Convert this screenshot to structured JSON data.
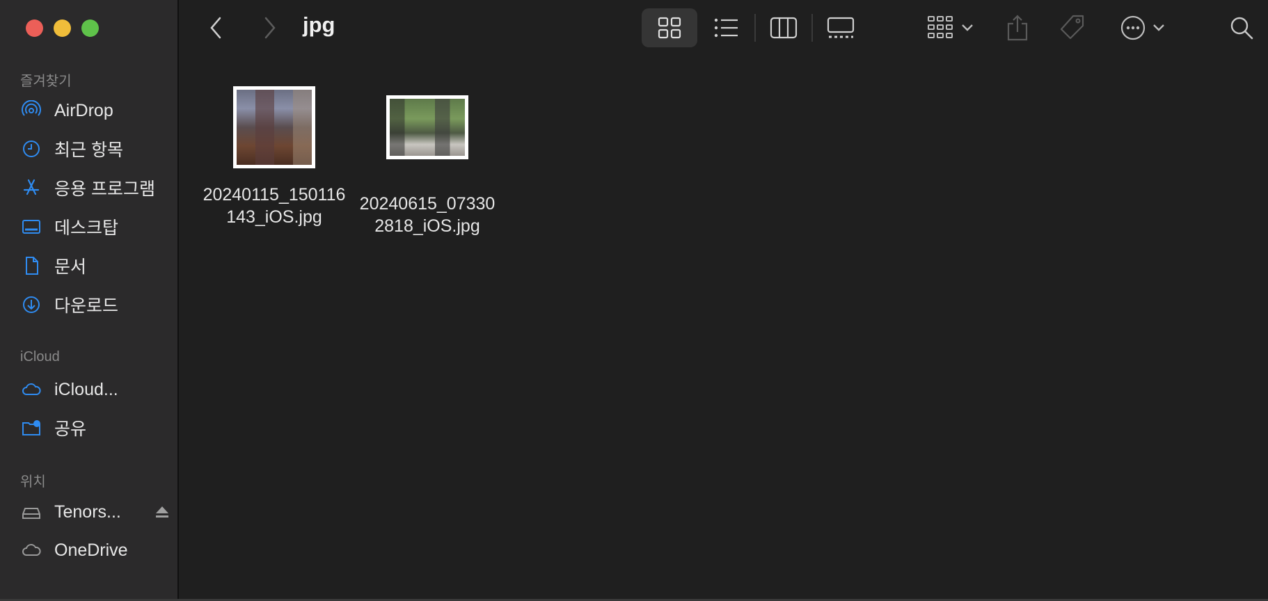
{
  "window": {
    "title": "jpg"
  },
  "sidebar": {
    "sections": [
      {
        "title": "즐겨찾기",
        "items": [
          {
            "label": "AirDrop",
            "icon": "airdrop-icon"
          },
          {
            "label": "최근 항목",
            "icon": "clock-icon"
          },
          {
            "label": "응용 프로그램",
            "icon": "applications-icon"
          },
          {
            "label": "데스크탑",
            "icon": "desktop-icon"
          },
          {
            "label": "문서",
            "icon": "document-icon"
          },
          {
            "label": "다운로드",
            "icon": "download-icon"
          }
        ]
      },
      {
        "title": "iCloud",
        "items": [
          {
            "label": "iCloud...",
            "icon": "cloud-icon"
          },
          {
            "label": "공유",
            "icon": "shared-folder-icon"
          }
        ]
      },
      {
        "title": "위치",
        "items": [
          {
            "label": "Tenors...",
            "icon": "drive-icon"
          },
          {
            "label": "OneDrive",
            "icon": "cloud-icon"
          }
        ]
      }
    ]
  },
  "toolbar": {
    "back": "chevron-left-icon",
    "forward": "chevron-right-icon",
    "views": [
      "icon-view",
      "list-view",
      "column-view",
      "gallery-view"
    ],
    "selected_view": "icon-view"
  },
  "files": [
    {
      "name": "20240115_150116\n143_iOS.jpg",
      "type": "jpg"
    },
    {
      "name": "20240615_07330\n2818_iOS.jpg",
      "type": "jpg"
    }
  ],
  "colors": {
    "accent": "#2f8cf2",
    "sidebar_bg": "#2b2a2b",
    "content_bg": "#1f1f1f"
  }
}
